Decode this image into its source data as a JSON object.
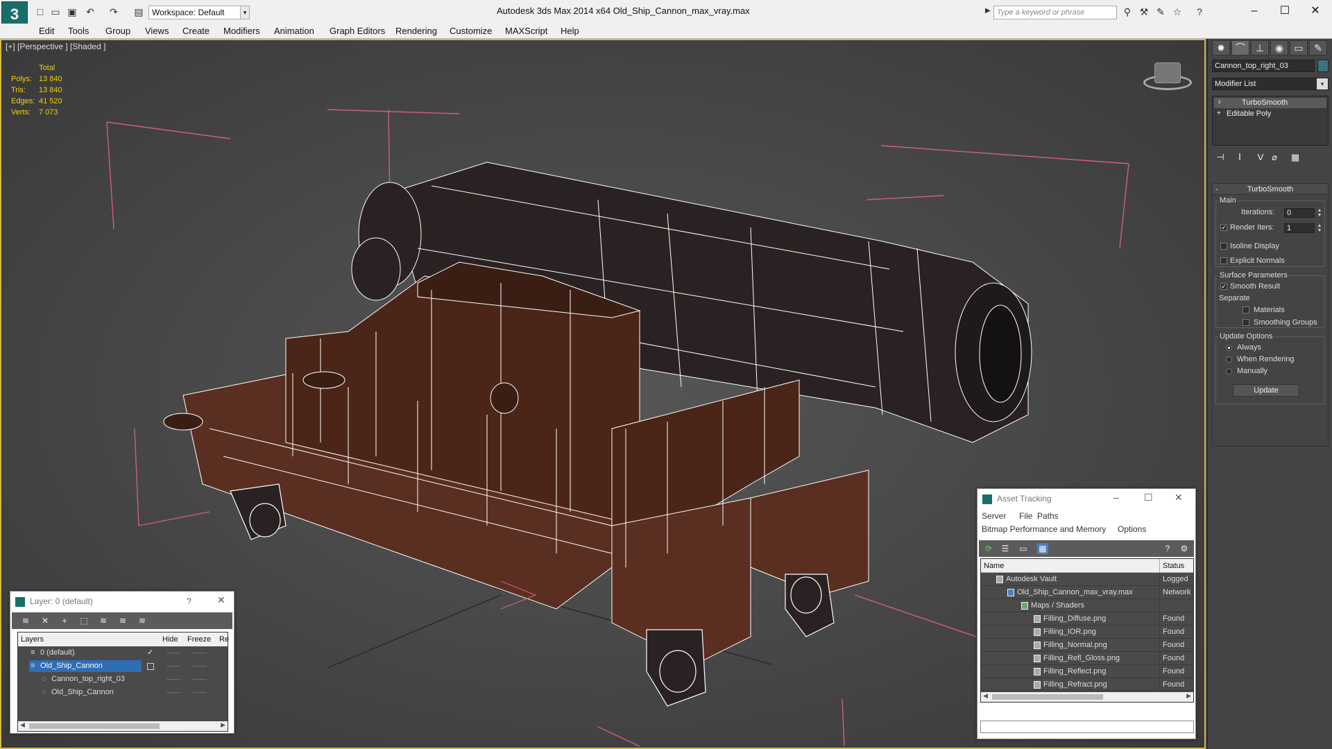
{
  "app": {
    "title": "Autodesk 3ds Max  2014 x64      Old_Ship_Cannon_max_vray.max",
    "workspace": "Workspace: Default",
    "search_placeholder": "Type a keyword or phrase"
  },
  "menu": [
    "Edit",
    "Tools",
    "Group",
    "Views",
    "Create",
    "Modifiers",
    "Animation",
    "Graph Editors",
    "Rendering",
    "Customize",
    "MAXScript",
    "Help"
  ],
  "viewport": {
    "label": "[+] [Perspective ] [Shaded ]",
    "stats_header": "Total",
    "stats": [
      {
        "k": "Polys:",
        "v": "13 840"
      },
      {
        "k": "Tris:",
        "v": "13 840"
      },
      {
        "k": "Edges:",
        "v": "41 520"
      },
      {
        "k": "Verts:",
        "v": "7 073"
      }
    ]
  },
  "command_panel": {
    "object_name": "Cannon_top_right_03",
    "object_color": "#3b7480",
    "modifier_list": "Modifier List",
    "stack": [
      "TurboSmooth",
      "Editable Poly"
    ],
    "rollout_title": "TurboSmooth",
    "main_label": "Main",
    "iterations_label": "Iterations:",
    "iterations_value": "0",
    "render_iters_label": "Render Iters:",
    "render_iters_value": "1",
    "isoline": "Isoline Display",
    "explicit_normals": "Explicit Normals",
    "surface_params": "Surface Parameters",
    "smooth_result": "Smooth Result",
    "separate": "Separate",
    "materials": "Materials",
    "smoothing_groups": "Smoothing Groups",
    "update_options": "Update Options",
    "always": "Always",
    "when_rendering": "When Rendering",
    "manually": "Manually",
    "update_btn": "Update"
  },
  "asset_tracking": {
    "title": "Asset Tracking",
    "menu1": [
      "Server",
      "File",
      "Paths"
    ],
    "menu2": [
      "Bitmap Performance and Memory",
      "Options"
    ],
    "col_name": "Name",
    "col_status": "Status",
    "rows": [
      {
        "name": "Autodesk Vault",
        "status": "Logged"
      },
      {
        "name": "Old_Ship_Cannon_max_vray.max",
        "status": "Network"
      },
      {
        "name": "Maps / Shaders",
        "status": ""
      },
      {
        "name": "Filling_Diffuse.png",
        "status": "Found"
      },
      {
        "name": "Filling_IOR.png",
        "status": "Found"
      },
      {
        "name": "Filling_Normal.png",
        "status": "Found"
      },
      {
        "name": "Filling_Refl_Gloss.png",
        "status": "Found"
      },
      {
        "name": "Filling_Reflect.png",
        "status": "Found"
      },
      {
        "name": "Filling_Refract.png",
        "status": "Found"
      }
    ]
  },
  "layer_window": {
    "title": "Layer: 0 (default)",
    "help": "?",
    "col_layers": "Layers",
    "col_hide": "Hide",
    "col_freeze": "Freeze",
    "col_re": "Re",
    "rows": [
      "0 (default)",
      "Old_Ship_Cannon",
      "Cannon_top_right_03",
      "Old_Ship_Cannon"
    ]
  }
}
